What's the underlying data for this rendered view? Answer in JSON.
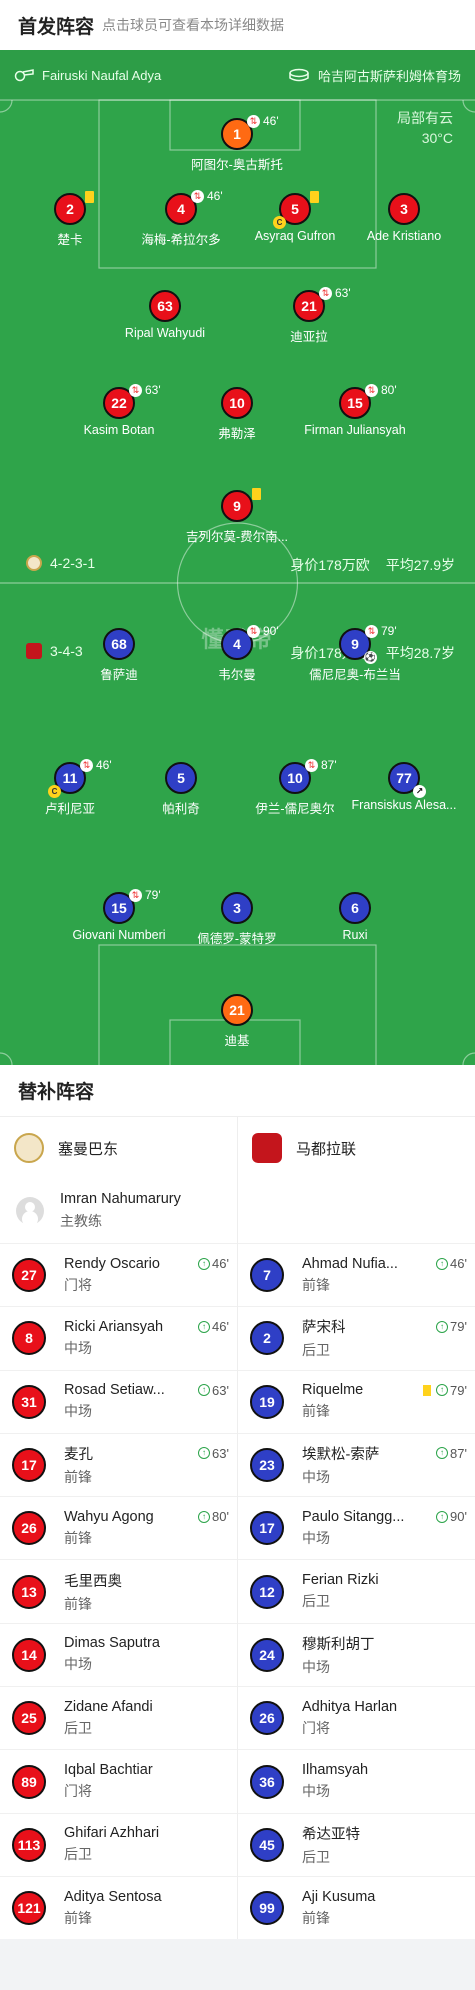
{
  "header": {
    "title": "首发阵容",
    "subtitle": "点击球员可查看本场详细数据"
  },
  "match": {
    "referee": "Fairuski Naufal Adya",
    "venue": "哈吉阿古斯萨利姆体育场",
    "weather": "局部有云",
    "temperature": "30°C",
    "watermark": "懂球帝"
  },
  "home": {
    "formation": "4-2-3-1",
    "value": "身价178万欧",
    "age": "平均27.9岁",
    "players": [
      {
        "num": "1",
        "name": "阿图尔-奥古斯托",
        "sub": "46'",
        "gk": true
      },
      {
        "num": "2",
        "name": "楚卡",
        "card": "yellow"
      },
      {
        "num": "4",
        "name": "海梅-希拉尔多",
        "sub": "46'"
      },
      {
        "num": "5",
        "name": "Asyraq Gufron",
        "card": "yellow",
        "captain": true
      },
      {
        "num": "3",
        "name": "Ade Kristiano"
      },
      {
        "num": "63",
        "name": "Ripal Wahyudi"
      },
      {
        "num": "21",
        "name": "迪亚拉",
        "sub": "63'"
      },
      {
        "num": "22",
        "name": "Kasim Botan",
        "sub": "63'"
      },
      {
        "num": "10",
        "name": "弗勒泽"
      },
      {
        "num": "15",
        "name": "Firman Juliansyah",
        "sub": "80'"
      },
      {
        "num": "9",
        "name": "吉列尔莫-费尔南...",
        "card": "yellow"
      }
    ]
  },
  "away": {
    "formation": "3-4-3",
    "value": "身价178万欧",
    "age": "平均28.7岁",
    "players": [
      {
        "num": "68",
        "name": "鲁萨迪"
      },
      {
        "num": "4",
        "name": "韦尔曼",
        "sub": "90'"
      },
      {
        "num": "9",
        "name": "儒尼尼奥-布兰当",
        "sub": "79'",
        "goal": true
      },
      {
        "num": "11",
        "name": "卢利尼亚",
        "sub": "46'",
        "captain": true
      },
      {
        "num": "5",
        "name": "帕利奇"
      },
      {
        "num": "10",
        "name": "伊兰-儒尼奥尔",
        "sub": "87'"
      },
      {
        "num": "77",
        "name": "Fransiskus Alesa...",
        "ball_white": true
      },
      {
        "num": "15",
        "name": "Giovani Numberi",
        "sub": "79'"
      },
      {
        "num": "3",
        "name": "佩德罗-蒙特罗"
      },
      {
        "num": "6",
        "name": "Ruxi"
      },
      {
        "num": "21",
        "name": "迪基",
        "gk": true
      }
    ]
  },
  "subs": {
    "title": "替补阵容",
    "home_team": "塞曼巴东",
    "away_team": "马都拉联",
    "coach": {
      "name": "Imran Nahumarury",
      "role": "主教练"
    },
    "home": [
      {
        "num": "27",
        "name": "Rendy Oscario",
        "pos": "门将",
        "in": "46'"
      },
      {
        "num": "8",
        "name": "Ricki Ariansyah",
        "pos": "中场",
        "in": "46'"
      },
      {
        "num": "31",
        "name": "Rosad Setiaw...",
        "pos": "中场",
        "in": "63'"
      },
      {
        "num": "17",
        "name": "麦孔",
        "pos": "前锋",
        "in": "63'"
      },
      {
        "num": "26",
        "name": "Wahyu Agong",
        "pos": "前锋",
        "in": "80'"
      },
      {
        "num": "13",
        "name": "毛里西奥",
        "pos": "前锋"
      },
      {
        "num": "14",
        "name": "Dimas Saputra",
        "pos": "中场"
      },
      {
        "num": "25",
        "name": "Zidane Afandi",
        "pos": "后卫"
      },
      {
        "num": "89",
        "name": "Iqbal Bachtiar",
        "pos": "门将"
      },
      {
        "num": "113",
        "name": "Ghifari Azhhari",
        "pos": "后卫"
      },
      {
        "num": "121",
        "name": "Aditya Sentosa",
        "pos": "前锋"
      }
    ],
    "away": [
      {
        "num": "7",
        "name": "Ahmad Nufia...",
        "pos": "前锋",
        "in": "46'"
      },
      {
        "num": "2",
        "name": "萨宋科",
        "pos": "后卫",
        "in": "79'"
      },
      {
        "num": "19",
        "name": "Riquelme",
        "pos": "前锋",
        "in": "79'",
        "card": "yellow"
      },
      {
        "num": "23",
        "name": "埃默松-索萨",
        "pos": "中场",
        "in": "87'"
      },
      {
        "num": "17",
        "name": "Paulo Sitangg...",
        "pos": "中场",
        "in": "90'"
      },
      {
        "num": "12",
        "name": "Ferian Rizki",
        "pos": "后卫"
      },
      {
        "num": "24",
        "name": "穆斯利胡丁",
        "pos": "中场"
      },
      {
        "num": "26",
        "name": "Adhitya Harlan",
        "pos": "门将"
      },
      {
        "num": "36",
        "name": "Ilhamsyah",
        "pos": "中场"
      },
      {
        "num": "45",
        "name": "希达亚特",
        "pos": "后卫"
      },
      {
        "num": "99",
        "name": "Aji Kusuma",
        "pos": "前锋"
      }
    ]
  }
}
